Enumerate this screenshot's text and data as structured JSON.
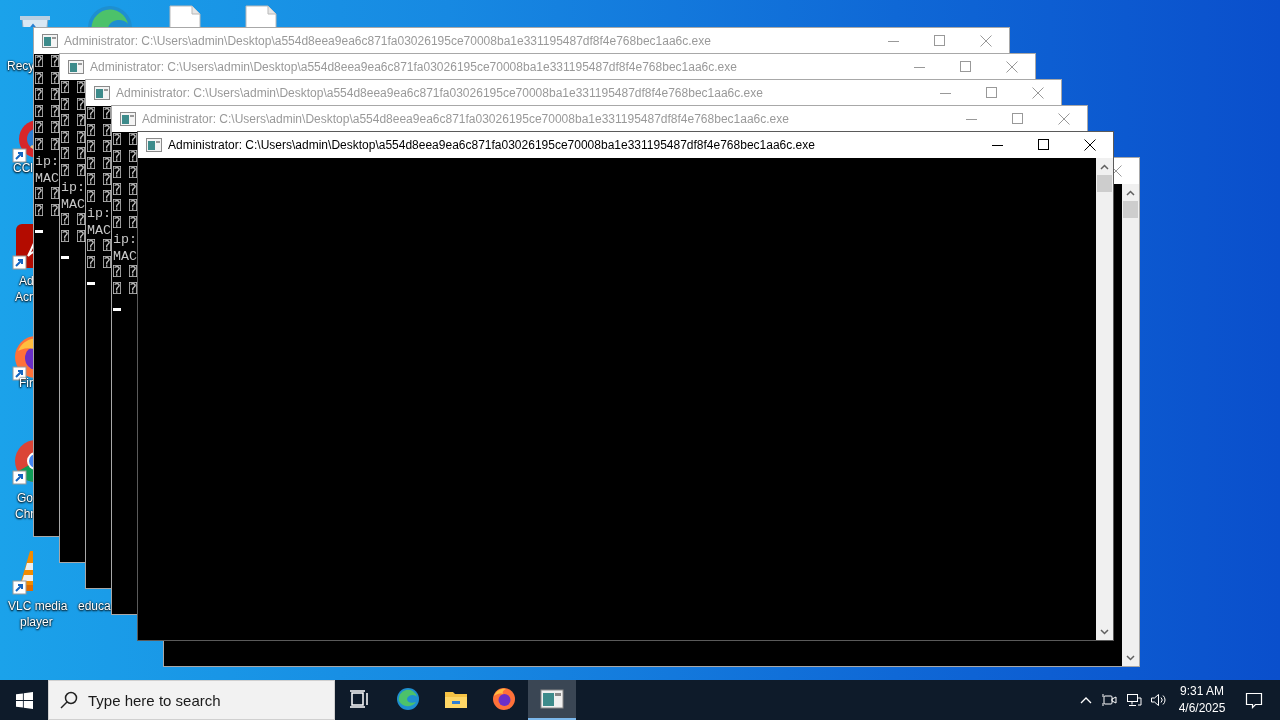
{
  "desktop": {
    "icons": [
      {
        "kind": "recycle",
        "label": [
          "Recy"
        ]
      },
      {
        "kind": "edge"
      },
      {
        "kind": "document"
      },
      {
        "kind": "document"
      },
      {
        "kind": "ccleaner",
        "label": [
          "CCl"
        ]
      },
      {
        "kind": "acrobat",
        "label": [
          "Ad",
          "Acr"
        ]
      },
      {
        "kind": "firefox",
        "label": [
          "Fir"
        ]
      },
      {
        "kind": "chrome",
        "label": [
          "Go",
          "Chr"
        ]
      },
      {
        "kind": "vlc",
        "label": [
          "VLC media",
          "player"
        ]
      },
      {
        "kind": "hidden",
        "label": [
          "educa"
        ]
      }
    ]
  },
  "windows": [
    {
      "title": "Administrator: C:\\Users\\admin\\Desktop\\a554d8eea9ea6c871fa03026195ce70008ba1e331195487df8f4e768bec1aa6c.exe",
      "active": false,
      "cursor": true,
      "lines": [
        "⍰ ⍰",
        "⍰ ⍰",
        "⍰ ⍰",
        "⍰ ⍰",
        "⍰ ⍰",
        "⍰ ⍰",
        "ip:",
        "MAC",
        "⍰ ⍰",
        "⍰ ⍰"
      ]
    },
    {
      "title": "Administrator: C:\\Users\\admin\\Desktop\\a554d8eea9ea6c871fa03026195ce70008ba1e331195487df8f4e768bec1aa6c.exe",
      "active": false,
      "cursor": true,
      "lines": [
        "⍰ ⍰",
        "⍰ ⍰",
        "⍰ ⍰",
        "⍰ ⍰",
        "⍰ ⍰",
        "⍰ ⍰",
        "ip:",
        "MAC",
        "⍰ ⍰",
        "⍰ ⍰"
      ]
    },
    {
      "title": "Administrator: C:\\Users\\admin\\Desktop\\a554d8eea9ea6c871fa03026195ce70008ba1e331195487df8f4e768bec1aa6c.exe",
      "active": false,
      "cursor": true,
      "lines": [
        "⍰ ⍰",
        "⍰ ⍰",
        "⍰ ⍰",
        "⍰ ⍰",
        "⍰ ⍰",
        "⍰ ⍰",
        "ip:",
        "MAC",
        "⍰ ⍰",
        "⍰ ⍰"
      ]
    },
    {
      "title": "Administrator: C:\\Users\\admin\\Desktop\\a554d8eea9ea6c871fa03026195ce70008ba1e331195487df8f4e768bec1aa6c.exe",
      "active": false,
      "cursor": true,
      "lines": [
        "⍰ ⍰",
        "⍰ ⍰",
        "⍰ ⍰",
        "⍰ ⍰",
        "⍰ ⍰",
        "⍰ ⍰",
        "ip:",
        "MAC",
        "⍰ ⍰",
        "⍰ ⍰"
      ]
    },
    {
      "active": false,
      "scroll_bar": true
    },
    {
      "title": "Administrator: C:\\Users\\admin\\Desktop\\a554d8eea9ea6c871fa03026195ce70008ba1e331195487df8f4e768bec1aa6c.exe",
      "active": true,
      "scroll_bar": true
    }
  ],
  "taskbar": {
    "search": {
      "placeholder": "Type here to search"
    },
    "apps": [
      {
        "kind": "task_view",
        "active": false
      },
      {
        "kind": "edge",
        "active": false
      },
      {
        "kind": "explorer",
        "active": false
      },
      {
        "kind": "firefox",
        "active": false
      },
      {
        "kind": "console",
        "active": true
      }
    ],
    "tray": {
      "time": "9:31 AM",
      "date": "4/6/2025"
    }
  }
}
